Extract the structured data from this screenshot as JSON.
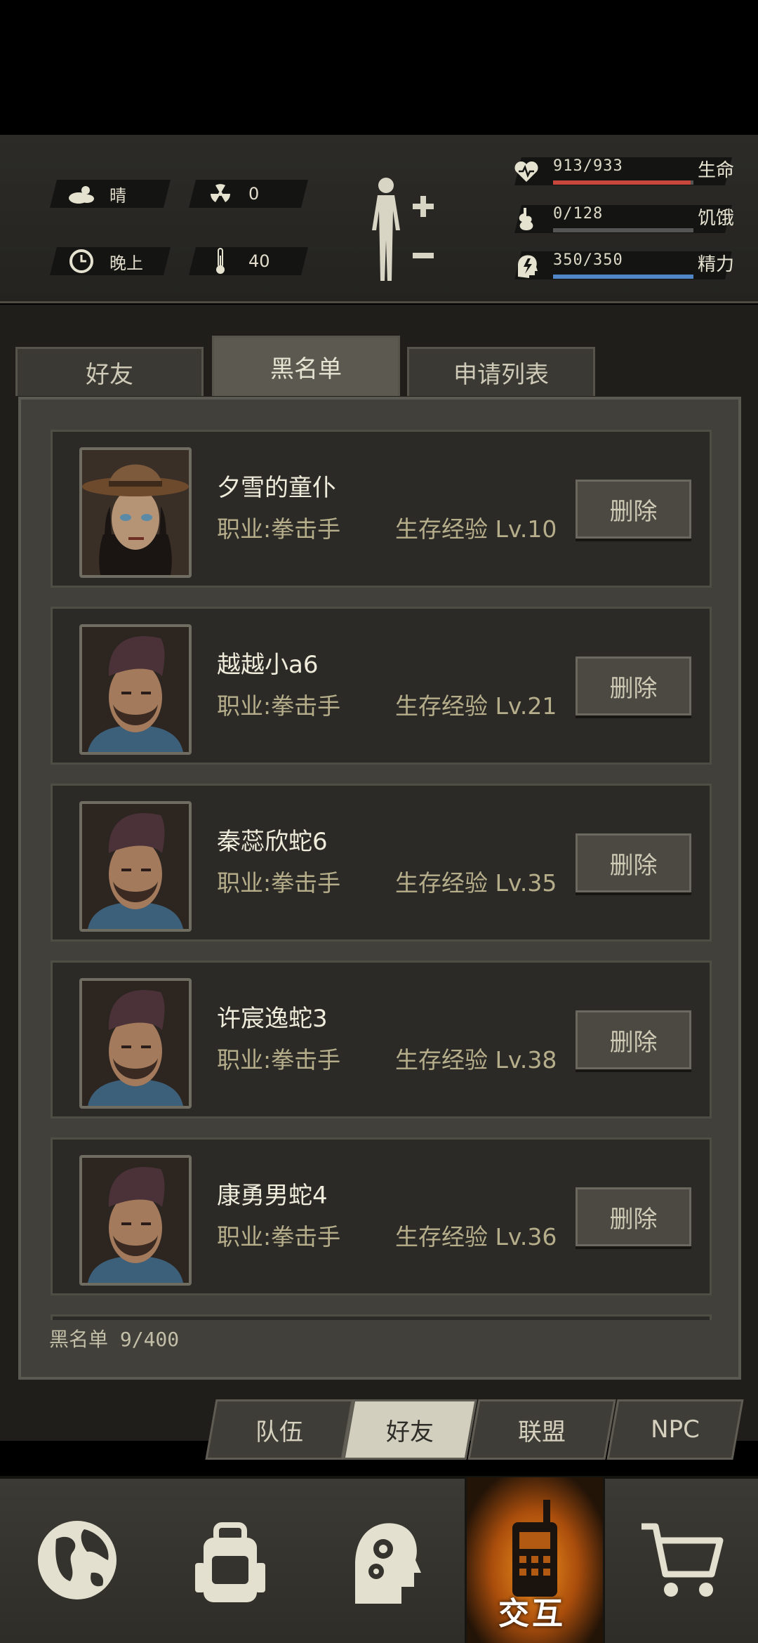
{
  "status": {
    "weather": {
      "icon": "cloud-sun-icon",
      "label": "晴"
    },
    "radiation": {
      "icon": "radiation-icon",
      "value": "0"
    },
    "time": {
      "icon": "clock-icon",
      "label": "晚上"
    },
    "temperature": {
      "icon": "thermometer-icon",
      "value": "40"
    },
    "vitals": [
      {
        "name": "生命",
        "value": "913/933",
        "current": 913,
        "max": 933,
        "color": "#c8473c",
        "icon": "heart-icon"
      },
      {
        "name": "饥饿",
        "value": "0/128",
        "current": 0,
        "max": 128,
        "color": "#666666",
        "icon": "stomach-icon"
      },
      {
        "name": "精力",
        "value": "350/350",
        "current": 350,
        "max": 350,
        "color": "#4f87c9",
        "icon": "energy-head-icon"
      }
    ]
  },
  "tabs": [
    {
      "label": "好友",
      "active": false
    },
    {
      "label": "黑名单",
      "active": true
    },
    {
      "label": "申请列表",
      "active": false
    }
  ],
  "blacklist": {
    "job_label": "职业:拳击手",
    "delete_label": "删除",
    "count_label": "黑名单 9/400",
    "items": [
      {
        "name": "夕雪的童仆",
        "exp": "生存经验 Lv.10",
        "avatar": "female-cowboy-hat-avatar"
      },
      {
        "name": "越越小a6",
        "exp": "生存经验 Lv.21",
        "avatar": "male-bearded-avatar"
      },
      {
        "name": "秦蕊欣蛇6",
        "exp": "生存经验 Lv.35",
        "avatar": "male-bearded-avatar"
      },
      {
        "name": "许宸逸蛇3",
        "exp": "生存经验 Lv.38",
        "avatar": "male-bearded-avatar"
      },
      {
        "name": "康勇男蛇4",
        "exp": "生存经验 Lv.36",
        "avatar": "male-bearded-avatar"
      }
    ]
  },
  "subtabs": [
    {
      "label": "队伍",
      "active": false
    },
    {
      "label": "好友",
      "active": true
    },
    {
      "label": "联盟",
      "active": false
    },
    {
      "label": "NPC",
      "active": false
    }
  ],
  "nav": [
    {
      "icon": "globe-icon",
      "active": false
    },
    {
      "icon": "backpack-icon",
      "active": false
    },
    {
      "icon": "head-gears-icon",
      "active": false
    },
    {
      "icon": "walkie-talkie-icon",
      "active": true,
      "label": "交互"
    },
    {
      "icon": "cart-icon",
      "active": false
    }
  ],
  "colors": {
    "accent": "#f2921e",
    "panel": "#41403a",
    "row": "#2b2a26"
  }
}
